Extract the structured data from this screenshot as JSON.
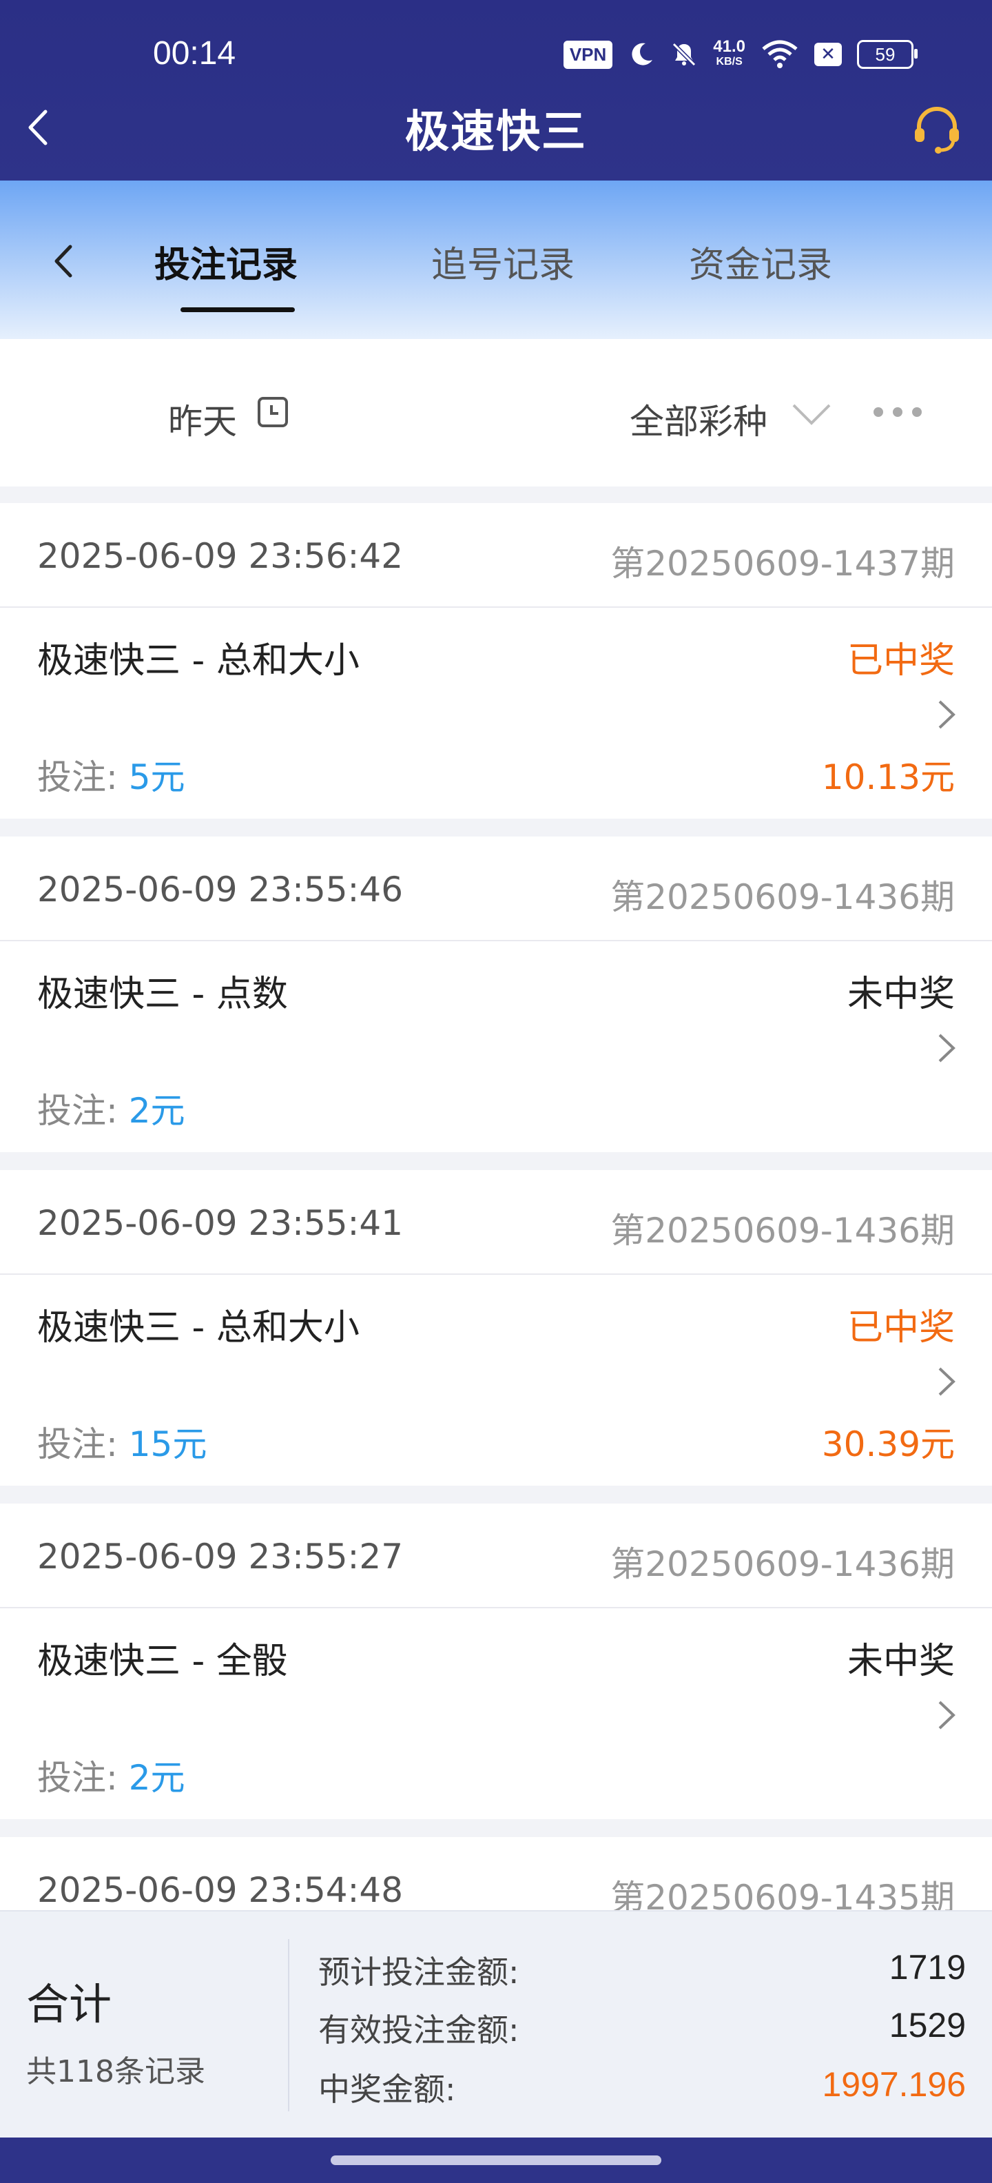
{
  "status_bar": {
    "time": "00:14",
    "vpn": "VPN",
    "speed_value": "41.0",
    "speed_unit": "KB/S",
    "battery": "59",
    "icons": [
      "moon-icon",
      "mute-bell-icon",
      "wifi-icon",
      "x-box-icon",
      "battery-icon"
    ]
  },
  "header": {
    "title": "极速快三",
    "back_icon": "chevron-left-icon",
    "support_icon": "headset-icon"
  },
  "tabs": [
    {
      "label": "投注记录",
      "active": true
    },
    {
      "label": "追号记录",
      "active": false
    },
    {
      "label": "资金记录",
      "active": false
    }
  ],
  "filter": {
    "date": "昨天",
    "lottery": "全部彩种"
  },
  "records": [
    {
      "time": "2025-06-09 23:56:42",
      "issue": "第20250609-1437期",
      "game": "极速快三 - 总和大小",
      "status": "已中奖",
      "win": true,
      "bet_label": "投注: ",
      "bet": "5元",
      "prize": "10.13元"
    },
    {
      "time": "2025-06-09 23:55:46",
      "issue": "第20250609-1436期",
      "game": "极速快三 - 点数",
      "status": "未中奖",
      "win": false,
      "bet_label": "投注: ",
      "bet": "2元",
      "prize": ""
    },
    {
      "time": "2025-06-09 23:55:41",
      "issue": "第20250609-1436期",
      "game": "极速快三 - 总和大小",
      "status": "已中奖",
      "win": true,
      "bet_label": "投注: ",
      "bet": "15元",
      "prize": "30.39元"
    },
    {
      "time": "2025-06-09 23:55:27",
      "issue": "第20250609-1436期",
      "game": "极速快三 - 全骰",
      "status": "未中奖",
      "win": false,
      "bet_label": "投注: ",
      "bet": "2元",
      "prize": ""
    },
    {
      "time": "2025-06-09 23:54:48",
      "issue": "第20250609-1435期",
      "game": "",
      "status": "",
      "win": false,
      "bet_label": "",
      "bet": "",
      "prize": ""
    }
  ],
  "summary": {
    "title": "合计",
    "count": "共118条记录",
    "rows": [
      {
        "label": "预计投注金额:",
        "value": "1719",
        "highlight": false
      },
      {
        "label": "有效投注金额:",
        "value": "1529",
        "highlight": false
      },
      {
        "label": "中奖金额:",
        "value": "1997.196",
        "highlight": true
      }
    ]
  },
  "colors": {
    "header_bg": "#2b2f86",
    "win": "#f26a12",
    "bet_amount": "#2a9ae8"
  }
}
